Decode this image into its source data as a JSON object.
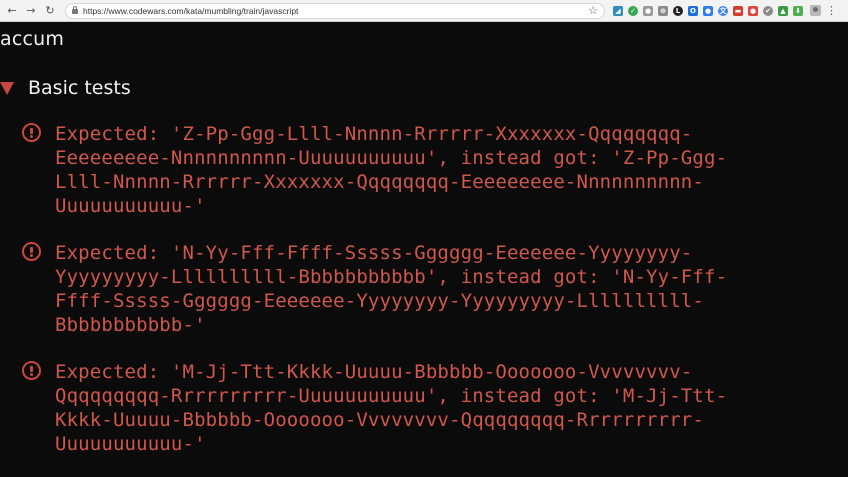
{
  "browser": {
    "back_icon": "←",
    "forward_icon": "→",
    "reload_icon": "↻",
    "url": "https://www.codewars.com/kata/mumbling/train/javascript",
    "star_icon": "☆",
    "menu_icon": "⋮",
    "extensions": [
      {
        "name": "chart-extension-icon",
        "glyph": "◢",
        "color": "#2e8bc0"
      },
      {
        "name": "green-check-extension-icon",
        "glyph": "✓",
        "color": "#3aa655"
      },
      {
        "name": "gray-circle-extension-icon",
        "glyph": "●",
        "color": "#9a9a9a"
      },
      {
        "name": "gray-round-extension-icon",
        "glyph": "⊕",
        "color": "#8c8c8c"
      },
      {
        "name": "l-extension-icon",
        "glyph": "L",
        "color": "#222222"
      },
      {
        "name": "blue-o-extension-icon",
        "glyph": "O",
        "color": "#1e6fd9"
      },
      {
        "name": "blue-dot-extension-icon",
        "glyph": "●",
        "color": "#2d7cf6"
      },
      {
        "name": "translate-extension-icon",
        "glyph": "文",
        "color": "#4285f4"
      },
      {
        "name": "red-card-extension-icon",
        "glyph": "▬",
        "color": "#d23b2f"
      },
      {
        "name": "red-round-extension-icon",
        "glyph": "●",
        "color": "#e0443a"
      },
      {
        "name": "check-extension-icon",
        "glyph": "✔",
        "color": "#8a8a8a"
      },
      {
        "name": "green-extension-icon",
        "glyph": "▲",
        "color": "#3c9b40"
      },
      {
        "name": "down-arrow-extension-icon",
        "glyph": "⬇",
        "color": "#4caf50"
      }
    ]
  },
  "kata": {
    "title": "accum",
    "group_label": "Basic tests",
    "failures": [
      {
        "lines": [
          "Expected: 'Z-Pp-Ggg-Llll-Nnnnn-Rrrrrr-Xxxxxxx-Qqqqqqqq-",
          "Eeeeeeeee-Nnnnnnnnnn-Uuuuuuuuuuu', instead got: 'Z-Pp-Ggg-",
          "Llll-Nnnnn-Rrrrrr-Xxxxxxx-Qqqqqqqq-Eeeeeeeee-Nnnnnnnnnn-",
          "Uuuuuuuuuuu-'"
        ]
      },
      {
        "lines": [
          "Expected: 'N-Yy-Fff-Ffff-Sssss-Gggggg-Eeeeeee-Yyyyyyyy-",
          "Yyyyyyyyy-Llllllllll-Bbbbbbbbbbb', instead got: 'N-Yy-Fff-",
          "Ffff-Sssss-Gggggg-Eeeeeee-Yyyyyyyy-Yyyyyyyyy-Llllllllll-",
          "Bbbbbbbbbbb-'"
        ]
      },
      {
        "lines": [
          "Expected: 'M-Jj-Ttt-Kkkk-Uuuuu-Bbbbbb-Ooooooo-Vvvvvvvv-",
          "Qqqqqqqqq-Rrrrrrrrrr-Uuuuuuuuuuu', instead got: 'M-Jj-Ttt-",
          "Kkkk-Uuuuu-Bbbbbb-Ooooooo-Vvvvvvvv-Qqqqqqqqq-Rrrrrrrrrr-",
          "Uuuuuuuuuuu-'"
        ]
      }
    ]
  },
  "colors": {
    "background": "#0b0b0b",
    "error_text": "#d0574b",
    "error_icon": "#c9473c",
    "heading_text": "#f0f0f0"
  }
}
